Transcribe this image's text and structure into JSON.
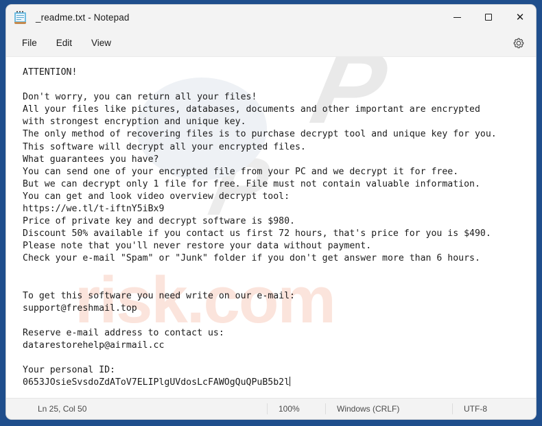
{
  "window": {
    "title": "_readme.txt - Notepad",
    "app_icon": "notepad-icon",
    "controls": {
      "minimize": "—",
      "maximize": "□",
      "close": "✕"
    },
    "frame_color": "#1f4e8c",
    "chrome_color": "#f3f3f3"
  },
  "menubar": {
    "items": [
      {
        "label": "File"
      },
      {
        "label": "Edit"
      },
      {
        "label": "View"
      }
    ],
    "settings_icon": "gear-icon"
  },
  "document": {
    "filename": "_readme.txt",
    "lines": [
      "ATTENTION!",
      "",
      "Don't worry, you can return all your files!",
      "All your files like pictures, databases, documents and other important are encrypted",
      "with strongest encryption and unique key.",
      "The only method of recovering files is to purchase decrypt tool and unique key for you.",
      "This software will decrypt all your encrypted files.",
      "What guarantees you have?",
      "You can send one of your encrypted file from your PC and we decrypt it for free.",
      "But we can decrypt only 1 file for free. File must not contain valuable information.",
      "You can get and look video overview decrypt tool:",
      "https://we.tl/t-iftnY5iBx9",
      "Price of private key and decrypt software is $980.",
      "Discount 50% available if you contact us first 72 hours, that's price for you is $490.",
      "Please note that you'll never restore your data without payment.",
      "Check your e-mail \"Spam\" or \"Junk\" folder if you don't get answer more than 6 hours.",
      "",
      "",
      "To get this software you need write on our e-mail:",
      "support@freshmail.top",
      "",
      "Reserve e-mail address to contact us:",
      "datarestorehelp@airmail.cc",
      "",
      "Your personal ID:",
      "0653JOsieSvsdoZdAToV7ELIPlgUVdosLcFAWOgQuQPuB5b2l"
    ],
    "ransom": {
      "url": "https://we.tl/t-iftnY5iBx9",
      "price_full": "$980",
      "price_discounted": "$490",
      "discount_percent": "50%",
      "discount_window_hours": "72",
      "reply_window_hours": "6",
      "email_primary": "support@freshmail.top",
      "email_reserve": "datarestorehelp@airmail.cc",
      "personal_id": "0653JOsieSvsdoZdAToV7ELIPlgUVdosLcFAWOgQuQPuB5b2l"
    },
    "watermarks": [
      "risk.com",
      "pcrisk"
    ]
  },
  "statusbar": {
    "position": "Ln 25, Col 50",
    "zoom": "100%",
    "line_ending": "Windows (CRLF)",
    "encoding": "UTF-8"
  }
}
